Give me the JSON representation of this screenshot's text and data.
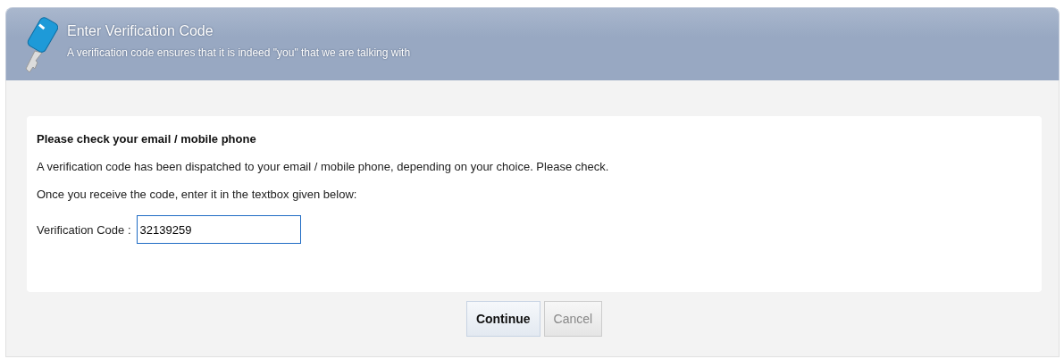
{
  "header": {
    "title": "Enter Verification Code",
    "subtitle": "A verification code ensures that it is indeed \"you\" that we are talking with"
  },
  "card": {
    "heading": "Please check your email / mobile phone",
    "paragraphs": [
      "A verification code has been dispatched to your email / mobile phone, depending on your choice. Please check.",
      "Once you receive the code, enter it in the textbox given below:"
    ],
    "field": {
      "label": "Verification Code :",
      "value": "32139259",
      "focused": true
    }
  },
  "buttons": [
    {
      "label": "Continue",
      "disabled": false
    },
    {
      "label": "Cancel",
      "disabled": true
    }
  ]
}
